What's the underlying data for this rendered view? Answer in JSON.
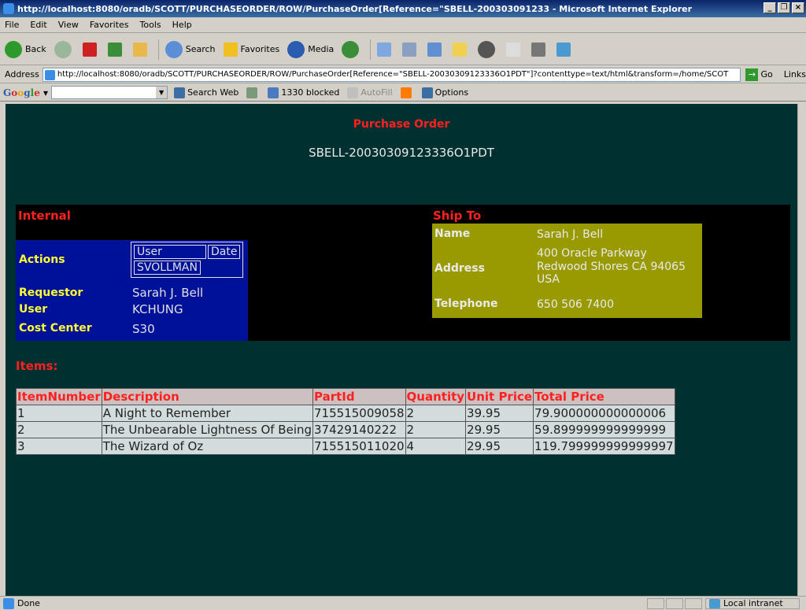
{
  "window": {
    "title": "http://localhost:8080/oradb/SCOTT/PURCHASEORDER/ROW/PurchaseOrder[Reference=\"SBELL-200303091233 - Microsoft Internet Explorer"
  },
  "menu": [
    "File",
    "Edit",
    "View",
    "Favorites",
    "Tools",
    "Help"
  ],
  "toolbar": {
    "back_label": "Back",
    "search_label": "Search",
    "favorites_label": "Favorites",
    "media_label": "Media"
  },
  "address": {
    "label": "Address",
    "url": "http://localhost:8080/oradb/SCOTT/PURCHASEORDER/ROW/PurchaseOrder[Reference=\"SBELL-20030309123336O1PDT\"]?contenttype=text/html&transform=/home/SCOT",
    "go_label": "Go",
    "links_label": "Links"
  },
  "google_bar": {
    "search_web_label": "Search Web",
    "blocked_label": "1330 blocked",
    "autofill_label": "AutoFill",
    "options_label": "Options"
  },
  "page": {
    "title": "Purchase Order",
    "reference": "SBELL-20030309123336O1PDT",
    "internal_heading": "Internal",
    "actions_label": "Actions",
    "actions_table": {
      "headers": [
        "User",
        "Date"
      ],
      "user": "SVOLLMAN"
    },
    "requestor_label": "Requestor",
    "requestor_value": "Sarah J. Bell",
    "user_label": "User",
    "user_value": "KCHUNG",
    "cost_center_label": "Cost Center",
    "cost_center_value": "S30",
    "ship_to_heading": "Ship To",
    "name_label": "Name",
    "name_value": "Sarah J. Bell",
    "address_label": "Address",
    "address_line1": "400 Oracle Parkway",
    "address_line2": "Redwood Shores CA 94065",
    "address_line3": "USA",
    "telephone_label": "Telephone",
    "telephone_value": "650 506 7400",
    "items_heading": "Items:",
    "items_headers": [
      "ItemNumber",
      "Description",
      "PartId",
      "Quantity",
      "Unit Price",
      "Total Price"
    ],
    "items": [
      [
        "1",
        "A Night to Remember",
        "715515009058",
        "2",
        "39.95",
        "79.900000000000006"
      ],
      [
        "2",
        "The Unbearable Lightness Of Being",
        "37429140222",
        "2",
        "29.95",
        "59.899999999999999"
      ],
      [
        "3",
        "The Wizard of Oz",
        "715515011020",
        "4",
        "29.95",
        "119.799999999999997"
      ]
    ]
  },
  "status": {
    "text": "Done",
    "zone": "Local intranet"
  }
}
